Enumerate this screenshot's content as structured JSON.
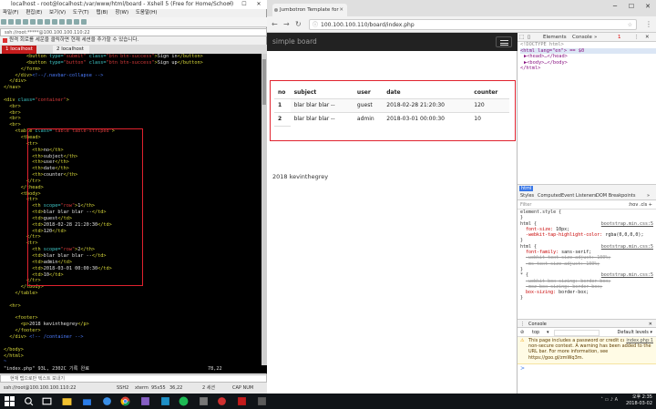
{
  "terminal": {
    "title": "localhost - root@localhost:/var/www/html/board - Xshell 5 (Free for Home/School)",
    "menu": [
      "파일(F)",
      "편집(E)",
      "보기(V)",
      "도구(T)",
      "탭(B)",
      "창(W)",
      "도움말(H)"
    ],
    "address": "ssh://root:*****@100.100.100.110:22",
    "info_bar": "원격 회로를 세운을 클릭하면 현재 세션을 추가할 수 있습니다.",
    "tabs": [
      {
        "label": "1 localhost"
      },
      {
        "label": "2 localhost"
      }
    ],
    "status_left": "\"index.php\" 93L, 2302C 기록 완료",
    "status_right": "78,22",
    "input_placeholder": "현재 탭으로만 텍스트 보내기",
    "bottom_bar": "ssh://root@100.100.100.110:22",
    "bottom_items": [
      "SSH2",
      "xterm",
      "95x55",
      "36,22",
      "2 세션",
      "CAP NUM"
    ]
  },
  "code_lines": [
    [
      {
        "c": "tx",
        "t": "        "
      },
      {
        "c": "tg",
        "t": "<button "
      },
      {
        "c": "at",
        "t": "type="
      },
      {
        "c": "st",
        "t": "\"submit\" "
      },
      {
        "c": "at",
        "t": "class="
      },
      {
        "c": "st",
        "t": "\"btn btn-success\""
      },
      {
        "c": "tg",
        "t": ">"
      },
      {
        "c": "tx",
        "t": "Sign in"
      },
      {
        "c": "tg",
        "t": "</button>"
      }
    ],
    [
      {
        "c": "tx",
        "t": "        "
      },
      {
        "c": "tg",
        "t": "<button "
      },
      {
        "c": "at",
        "t": "type="
      },
      {
        "c": "st",
        "t": "\"button\" "
      },
      {
        "c": "at",
        "t": "class="
      },
      {
        "c": "st",
        "t": "\"btn btn-success\""
      },
      {
        "c": "tg",
        "t": ">"
      },
      {
        "c": "tx",
        "t": "Sign up"
      },
      {
        "c": "tg",
        "t": "</button>"
      }
    ],
    [
      {
        "c": "tx",
        "t": "      "
      },
      {
        "c": "tg",
        "t": "</form>"
      }
    ],
    [
      {
        "c": "tx",
        "t": "    "
      },
      {
        "c": "tg",
        "t": "</div>"
      },
      {
        "c": "cm",
        "t": "<!--/.navbar-collapse -->"
      }
    ],
    [
      {
        "c": "tx",
        "t": "  "
      },
      {
        "c": "tg",
        "t": "</div>"
      }
    ],
    [
      {
        "c": "tg",
        "t": "</nav>"
      }
    ],
    [
      {
        "c": "tx",
        "t": ""
      }
    ],
    [
      {
        "c": "tg",
        "t": "<div "
      },
      {
        "c": "at",
        "t": "class="
      },
      {
        "c": "st",
        "t": "\"container\""
      },
      {
        "c": "tg",
        "t": ">"
      }
    ],
    [
      {
        "c": "tx",
        "t": "  "
      },
      {
        "c": "tg",
        "t": "<br>"
      }
    ],
    [
      {
        "c": "tx",
        "t": "  "
      },
      {
        "c": "tg",
        "t": "<br>"
      }
    ],
    [
      {
        "c": "tx",
        "t": "  "
      },
      {
        "c": "tg",
        "t": "<br>"
      }
    ],
    [
      {
        "c": "tx",
        "t": "  "
      },
      {
        "c": "tg",
        "t": "<br>"
      }
    ],
    [
      {
        "c": "tx",
        "t": "    "
      },
      {
        "c": "tg",
        "t": "<table "
      },
      {
        "c": "at",
        "t": "class="
      },
      {
        "c": "st",
        "t": "\"table table-striped\""
      },
      {
        "c": "tg",
        "t": ">"
      }
    ],
    [
      {
        "c": "tx",
        "t": "      "
      },
      {
        "c": "tg",
        "t": "<thead>"
      }
    ],
    [
      {
        "c": "tx",
        "t": "        "
      },
      {
        "c": "tg",
        "t": "<tr>"
      }
    ],
    [
      {
        "c": "tx",
        "t": "          "
      },
      {
        "c": "tg",
        "t": "<th>"
      },
      {
        "c": "tx",
        "t": "no"
      },
      {
        "c": "tg",
        "t": "</th>"
      }
    ],
    [
      {
        "c": "tx",
        "t": "          "
      },
      {
        "c": "tg",
        "t": "<th>"
      },
      {
        "c": "tx",
        "t": "subject"
      },
      {
        "c": "tg",
        "t": "</th>"
      }
    ],
    [
      {
        "c": "tx",
        "t": "          "
      },
      {
        "c": "tg",
        "t": "<th>"
      },
      {
        "c": "tx",
        "t": "user"
      },
      {
        "c": "tg",
        "t": "</th>"
      }
    ],
    [
      {
        "c": "tx",
        "t": "          "
      },
      {
        "c": "tg",
        "t": "<th>"
      },
      {
        "c": "tx",
        "t": "date"
      },
      {
        "c": "tg",
        "t": "</th>"
      }
    ],
    [
      {
        "c": "tx",
        "t": "          "
      },
      {
        "c": "tg",
        "t": "<th>"
      },
      {
        "c": "tx",
        "t": "counter"
      },
      {
        "c": "tg",
        "t": "</th>"
      }
    ],
    [
      {
        "c": "tx",
        "t": "        "
      },
      {
        "c": "tg",
        "t": "</tr>"
      }
    ],
    [
      {
        "c": "tx",
        "t": "      "
      },
      {
        "c": "tg",
        "t": "</thead>"
      }
    ],
    [
      {
        "c": "tx",
        "t": "      "
      },
      {
        "c": "tg",
        "t": "<tbody>"
      }
    ],
    [
      {
        "c": "tx",
        "t": "        "
      },
      {
        "c": "tg",
        "t": "<tr>"
      }
    ],
    [
      {
        "c": "tx",
        "t": "          "
      },
      {
        "c": "tg",
        "t": "<th "
      },
      {
        "c": "at",
        "t": "scope="
      },
      {
        "c": "st",
        "t": "\"row\""
      },
      {
        "c": "tg",
        "t": ">"
      },
      {
        "c": "tx",
        "t": "1"
      },
      {
        "c": "tg",
        "t": "</th>"
      }
    ],
    [
      {
        "c": "tx",
        "t": "          "
      },
      {
        "c": "tg",
        "t": "<td>"
      },
      {
        "c": "tx",
        "t": "blar blar blar --"
      },
      {
        "c": "tg",
        "t": "</td>"
      }
    ],
    [
      {
        "c": "tx",
        "t": "          "
      },
      {
        "c": "tg",
        "t": "<td>"
      },
      {
        "c": "tx",
        "t": "guest"
      },
      {
        "c": "tg",
        "t": "</td>"
      }
    ],
    [
      {
        "c": "tx",
        "t": "          "
      },
      {
        "c": "tg",
        "t": "<td>"
      },
      {
        "c": "tx",
        "t": "2018-02-28 21:20:30"
      },
      {
        "c": "tg",
        "t": "</td>"
      }
    ],
    [
      {
        "c": "tx",
        "t": "          "
      },
      {
        "c": "tg",
        "t": "<td>"
      },
      {
        "c": "tx",
        "t": "120"
      },
      {
        "c": "tg",
        "t": "</td>"
      }
    ],
    [
      {
        "c": "tx",
        "t": "        "
      },
      {
        "c": "tg",
        "t": "</tr>"
      }
    ],
    [
      {
        "c": "tx",
        "t": "        "
      },
      {
        "c": "tg",
        "t": "<tr>"
      }
    ],
    [
      {
        "c": "tx",
        "t": "          "
      },
      {
        "c": "tg",
        "t": "<th "
      },
      {
        "c": "at",
        "t": "scope="
      },
      {
        "c": "st",
        "t": "\"row\""
      },
      {
        "c": "tg",
        "t": ">"
      },
      {
        "c": "tx",
        "t": "2"
      },
      {
        "c": "tg",
        "t": "</th>"
      }
    ],
    [
      {
        "c": "tx",
        "t": "          "
      },
      {
        "c": "tg",
        "t": "<td>"
      },
      {
        "c": "tx",
        "t": "blar blar blar --"
      },
      {
        "c": "tg",
        "t": "</td>"
      }
    ],
    [
      {
        "c": "tx",
        "t": "          "
      },
      {
        "c": "tg",
        "t": "<td>"
      },
      {
        "c": "tx",
        "t": "admin"
      },
      {
        "c": "tg",
        "t": "</td>"
      }
    ],
    [
      {
        "c": "tx",
        "t": "          "
      },
      {
        "c": "tg",
        "t": "<td>"
      },
      {
        "c": "tx",
        "t": "2018-03-01 00:00:30"
      },
      {
        "c": "tg",
        "t": "</td>"
      }
    ],
    [
      {
        "c": "tx",
        "t": "          "
      },
      {
        "c": "tg",
        "t": "<td>"
      },
      {
        "c": "tx",
        "t": "10"
      },
      {
        "c": "tg",
        "t": "</td>"
      }
    ],
    [
      {
        "c": "tx",
        "t": "        "
      },
      {
        "c": "tg",
        "t": "</tr>"
      }
    ],
    [
      {
        "c": "tx",
        "t": "      "
      },
      {
        "c": "tg",
        "t": "</tbody>"
      }
    ],
    [
      {
        "c": "tx",
        "t": "    "
      },
      {
        "c": "tg",
        "t": "</table>"
      }
    ],
    [
      {
        "c": "tx",
        "t": ""
      }
    ],
    [
      {
        "c": "tx",
        "t": "  "
      },
      {
        "c": "tg",
        "t": "<hr>"
      }
    ],
    [
      {
        "c": "tx",
        "t": ""
      }
    ],
    [
      {
        "c": "tx",
        "t": "    "
      },
      {
        "c": "tg",
        "t": "<footer>"
      }
    ],
    [
      {
        "c": "tx",
        "t": "      "
      },
      {
        "c": "tg",
        "t": "<p>"
      },
      {
        "c": "tx",
        "t": "2018 kevinthegrey"
      },
      {
        "c": "tg",
        "t": "</p>"
      }
    ],
    [
      {
        "c": "tx",
        "t": "    "
      },
      {
        "c": "tg",
        "t": "</footer>"
      }
    ],
    [
      {
        "c": "tx",
        "t": "  "
      },
      {
        "c": "tg",
        "t": "</div> "
      },
      {
        "c": "cm",
        "t": "<!-- /container -->"
      }
    ],
    [
      {
        "c": "tx",
        "t": ""
      }
    ],
    [
      {
        "c": "tg",
        "t": "</body>"
      }
    ],
    [
      {
        "c": "tg",
        "t": "</html>"
      }
    ],
    [
      {
        "c": "tl",
        "t": "~"
      }
    ],
    [
      {
        "c": "tl",
        "t": "~"
      }
    ],
    [
      {
        "c": "tl",
        "t": "~"
      }
    ]
  ],
  "browser": {
    "tab_title": "Jumbotron Template for",
    "url": "100.100.100.110/board/index.php",
    "brand": "simple board",
    "table": {
      "headers": [
        "no",
        "subject",
        "user",
        "date",
        "counter"
      ],
      "rows": [
        [
          "1",
          "blar blar blar --",
          "guest",
          "2018-02-28 21:20:30",
          "120"
        ],
        [
          "2",
          "blar blar blar --",
          "admin",
          "2018-03-01 00:00:30",
          "10"
        ]
      ]
    },
    "footer": "2018 kevinthegrey"
  },
  "devtools": {
    "tabs": [
      "Elements",
      "Console"
    ],
    "error_count": "1",
    "element_lines": [
      "<!DOCTYPE html>",
      "<html lang=\"en\"> == $0",
      "▶<head>…</head>",
      "▶<body>…</body>",
      "</html>"
    ],
    "breadcrumb": "html",
    "subtabs": [
      "Styles",
      "Computed",
      "Event Listeners",
      "DOM Breakpoints"
    ],
    "filter_placeholder": "Filter",
    "filter_right": ":hov .cls +",
    "styles": {
      "element_style": "element.style {",
      "rule1_selector": "html {",
      "rule1_src": "bootstrap.min.css:5",
      "rule1_props": [
        [
          "font-size",
          "10px;",
          false
        ],
        [
          "-webkit-tap-highlight-color",
          "rgba(0,0,0,0);",
          false
        ]
      ],
      "rule2_selector": "html {",
      "rule2_src": "bootstrap.min.css:5",
      "rule2_props": [
        [
          "font-family",
          "sans-serif;",
          false
        ],
        [
          "-webkit-text-size-adjust",
          "100%;",
          true
        ],
        [
          "-ms-text-size-adjust",
          "100%;",
          true
        ]
      ],
      "rule3_selector": "* {",
      "rule3_src": "bootstrap.min.css:5",
      "rule3_props": [
        [
          "-webkit-box-sizing",
          "border-box;",
          true
        ],
        [
          "-moz-box-sizing",
          "border-box;",
          true
        ],
        [
          "box-sizing",
          "border-box;",
          false
        ]
      ]
    },
    "console_tab": "Console",
    "console_context": "top",
    "console_levels": "Default levels ▾",
    "warning": "This page includes a password or credit card input in a non-secure context. A warning has been added to the URL bar. For more information, see https://goo.gl/zmWq3m.",
    "warning_src": "index.php:1",
    "prompt": ">"
  },
  "taskbar": {
    "time": "오후 2:35",
    "date": "2018-03-02",
    "lang": "A"
  }
}
